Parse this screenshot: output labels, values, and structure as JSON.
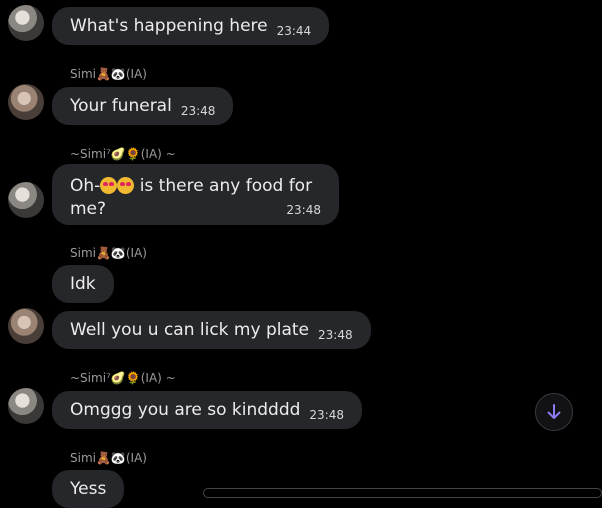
{
  "messages": [
    {
      "text": "What's happening here",
      "time": "23:44"
    },
    {
      "sender": "Simi🧸🐼(IA)",
      "text": "Your funeral",
      "time": "23:48"
    },
    {
      "sender": "~Simi⁷🥑🌻(IA) ~",
      "text_before": "Oh-",
      "text_after": " is there any food for me?",
      "time": "23:48"
    },
    {
      "sender": "Simi🧸🐼(IA)",
      "text": "Idk"
    },
    {
      "text": "Well you u can lick my plate",
      "time": "23:48"
    },
    {
      "sender": "~Simi⁷🥑🌻(IA) ~",
      "text": "Omggg you are so kindddd",
      "time": "23:48"
    },
    {
      "sender": "Simi🧸🐼(IA)",
      "text": "Yess"
    }
  ],
  "icons": {
    "scroll_down": "arrow-down-icon",
    "emoji": "heart-eyes-emoji-icon"
  },
  "colors": {
    "background": "#000000",
    "bubble": "#26272b",
    "accent": "#8b7cf6"
  }
}
